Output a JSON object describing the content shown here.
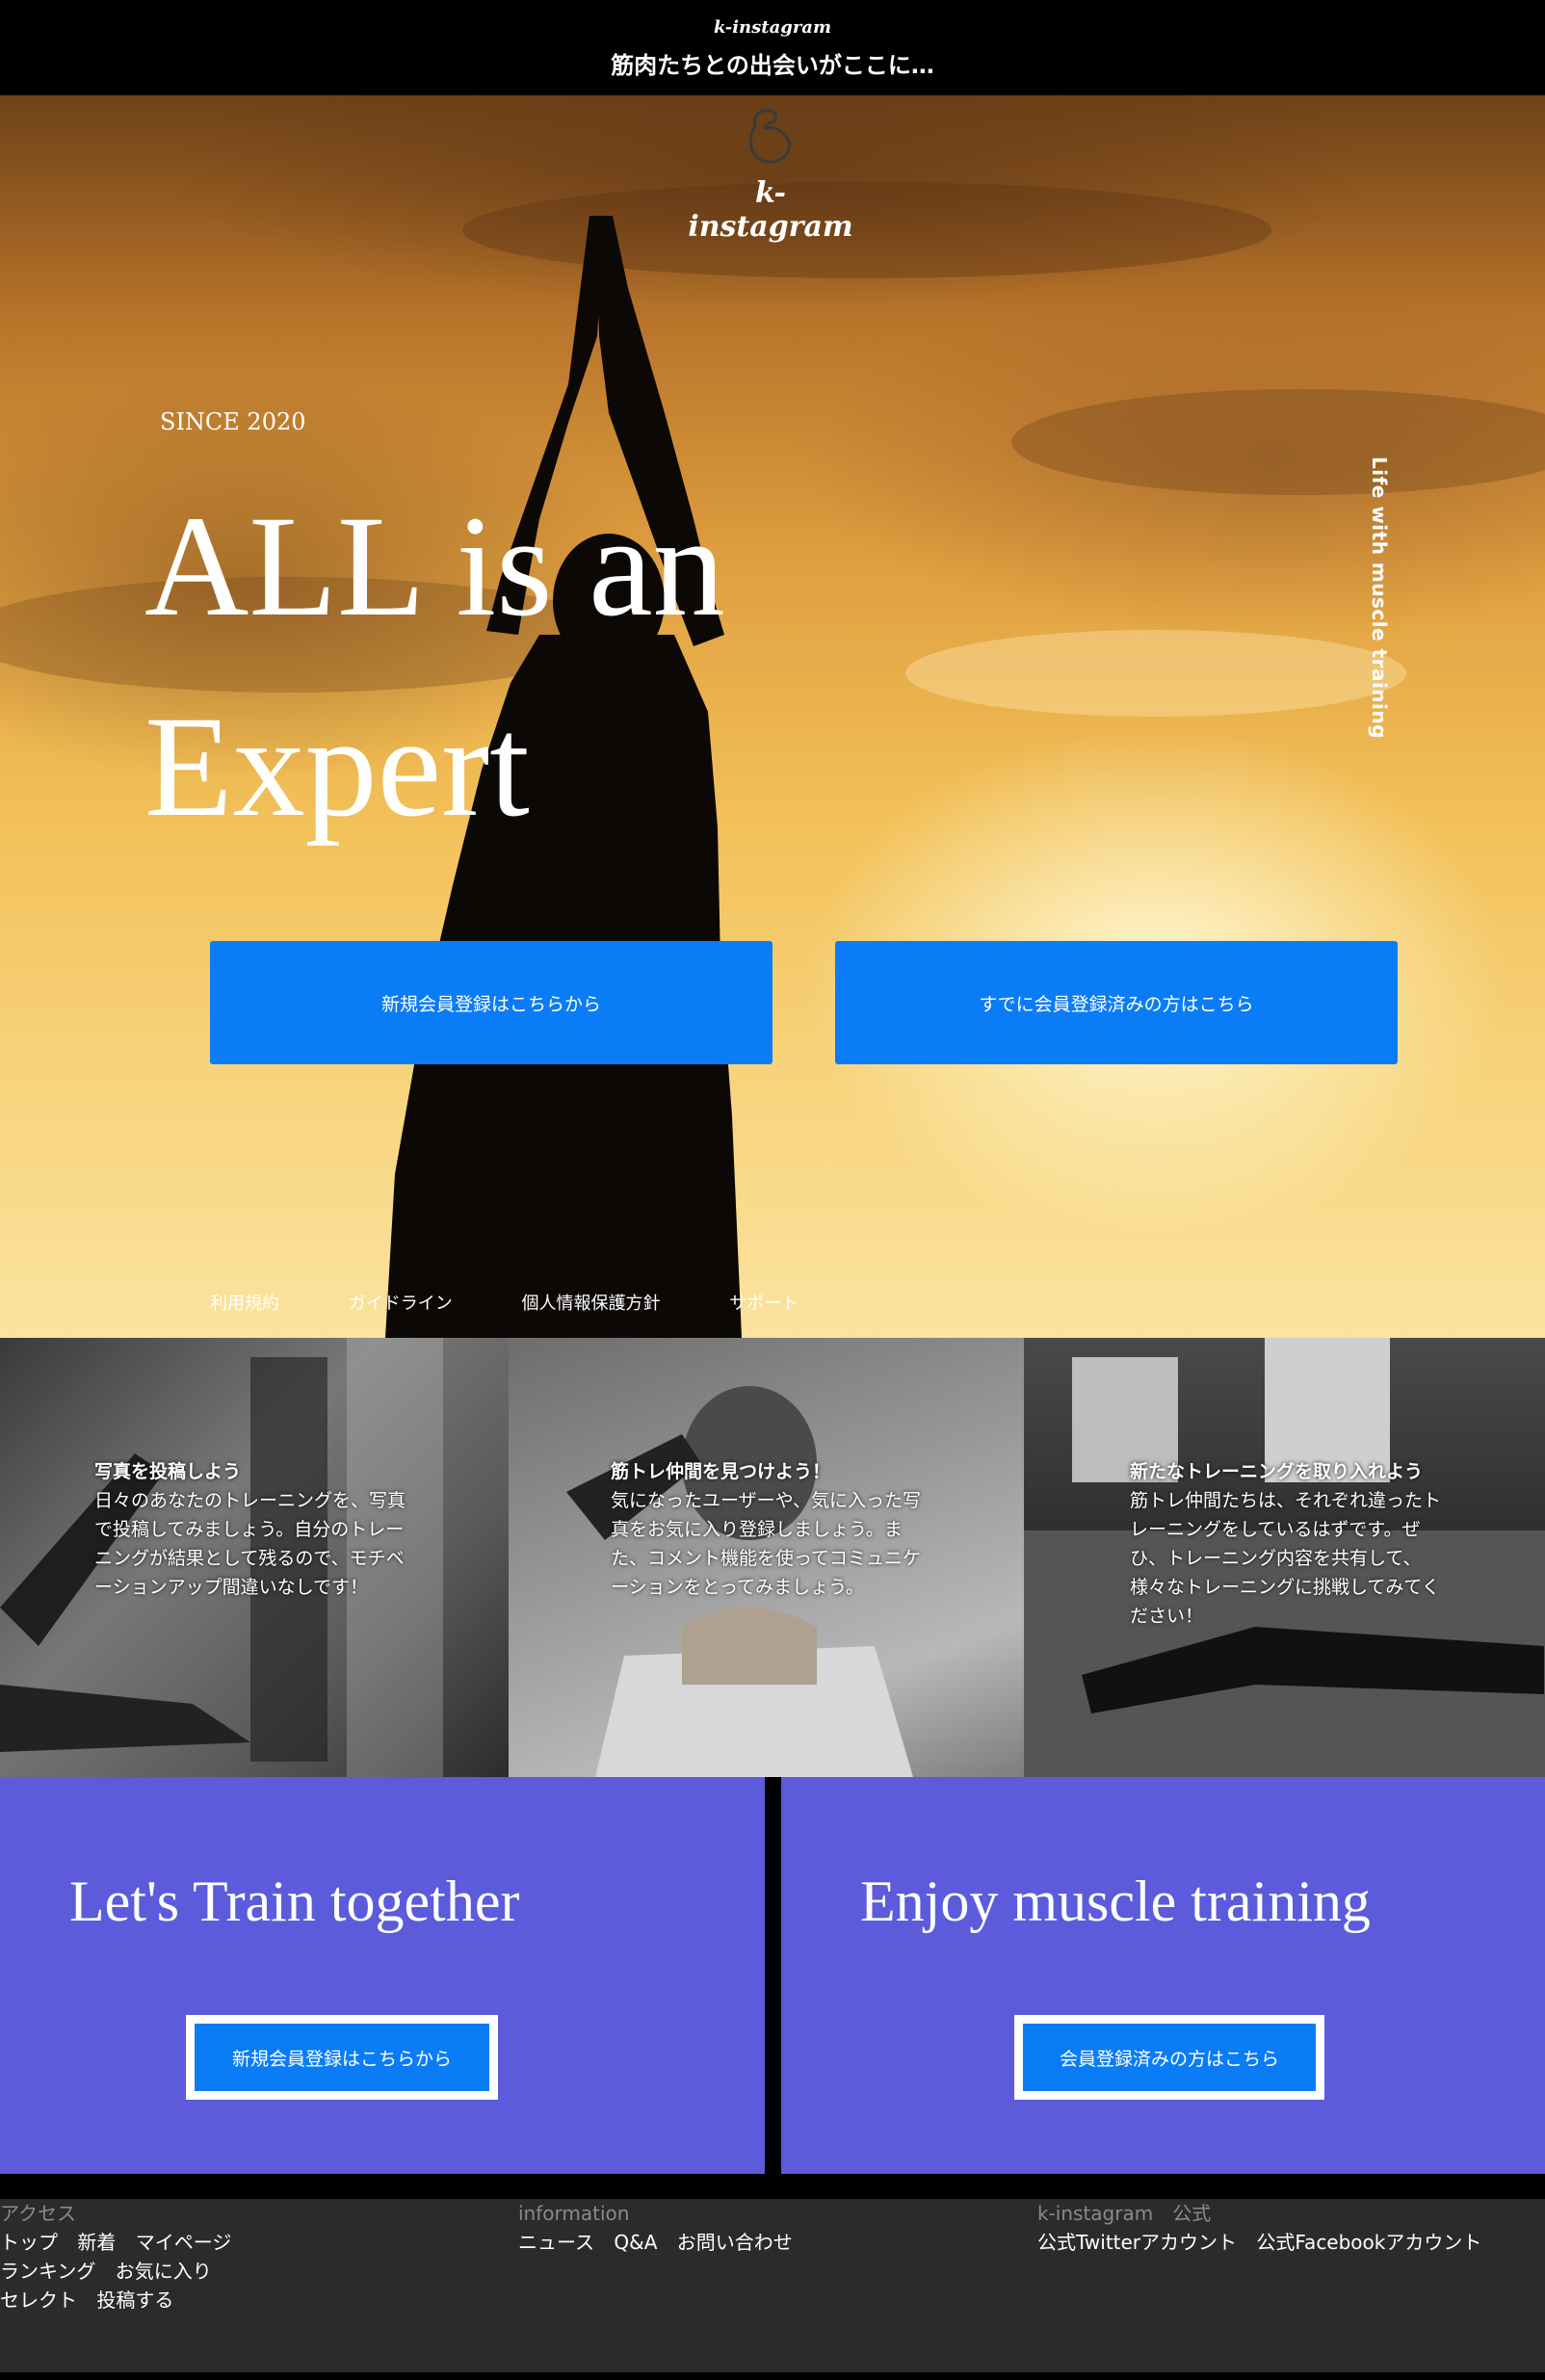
{
  "header": {
    "brand": "k-instagram",
    "tagline": "筋肉たちとの出会いがここに…"
  },
  "hero": {
    "logo_text": "k-instagram",
    "since": "SINCE 2020",
    "headline_line1": "ALL is an",
    "headline_line2": "Expert",
    "vertical_text": "Life with muscle training",
    "register_button": "新規会員登録はこちらから",
    "login_button": "すでに会員登録済みの方はこちら",
    "links": [
      "利用規約",
      "ガイドライン",
      "個人情報保護方針",
      "サポート"
    ]
  },
  "panels": [
    {
      "title": "写真を投稿しよう",
      "body": "日々のあなたのトレーニングを、写真で投稿してみましょう。自分のトレーニングが結果として残るので、モチベーションアップ間違いなしです！"
    },
    {
      "title": "筋トレ仲間を見つけよう！",
      "body": "気になったユーザーや、気に入った写真をお気に入り登録しましょう。また、コメント機能を使ってコミュニケーションをとってみましょう。"
    },
    {
      "title": "新たなトレーニングを取り入れよう",
      "body": "筋トレ仲間たちは、それぞれ違ったトレーニングをしているはずです。ぜひ、トレーニング内容を共有して、様々なトレーニングに挑戦してみてください！"
    }
  ],
  "cta": {
    "left_heading": "Let's Train together",
    "left_button": "新規会員登録はこちらから",
    "right_heading": "Enjoy muscle training",
    "right_button": "会員登録済みの方はこちら"
  },
  "footer": {
    "col1": {
      "heading": "アクセス",
      "row1": [
        "トップ",
        "新着",
        "マイページ"
      ],
      "row2": [
        "ランキング",
        "お気に入り"
      ],
      "row3": [
        "セレクト",
        "投稿する"
      ]
    },
    "col2": {
      "heading": "information",
      "row1": [
        "ニュース",
        "Q&A",
        "お問い合わせ"
      ]
    },
    "col3": {
      "heading": "k-instagram　公式",
      "row1": [
        "公式Twitterアカウント",
        "公式Facebookアカウント"
      ]
    }
  },
  "colors": {
    "primary_button": "#0a7cf6",
    "cta_background": "#5b5bdc",
    "footer_background": "#2b2b2b"
  }
}
